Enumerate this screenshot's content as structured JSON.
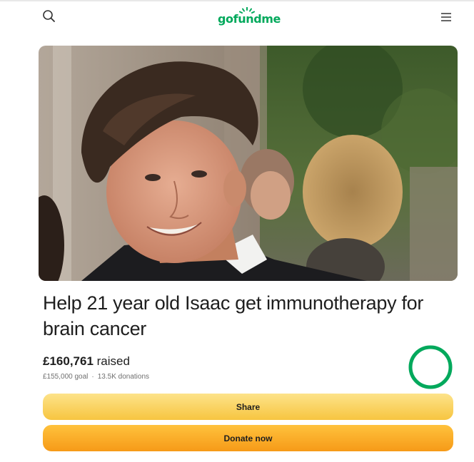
{
  "header": {
    "logo_text": "gofundme",
    "search_icon": "search-icon",
    "menu_icon": "hamburger-menu-icon"
  },
  "hero": {
    "image_icon": "campaign-photo"
  },
  "campaign": {
    "title": "Help 21 year old Isaac get immunotherapy for brain cancer",
    "raised_amount": "£160,761",
    "raised_suffix": "raised",
    "goal": "£155,000 goal",
    "separator": "·",
    "donations": "13.5K donations",
    "progress_fraction": 1.0
  },
  "actions": {
    "share_label": "Share",
    "donate_label": "Donate now"
  },
  "colors": {
    "brand_green": "#02a95c",
    "share_yellow": "#f7c540",
    "donate_orange": "#f69a18"
  }
}
